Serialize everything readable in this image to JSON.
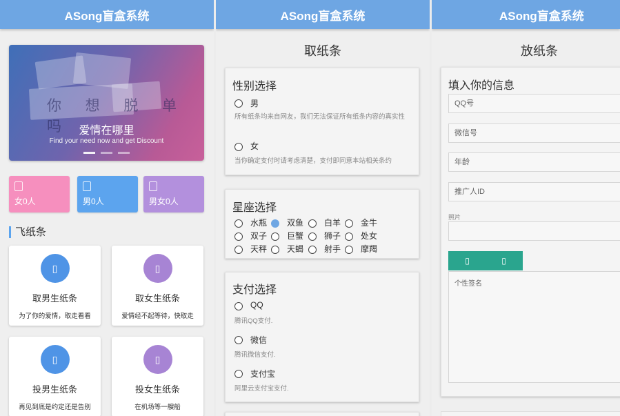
{
  "app_title": "ASong盲盒系统",
  "home": {
    "banner": {
      "title": "爱情在哪里",
      "subtitle": "Find your need now and get Discount",
      "bg_text": "你 想 脱 单 吗"
    },
    "stats": [
      {
        "label": "女0人",
        "color": "#f68fbe",
        "icon": "female-icon"
      },
      {
        "label": "男0人",
        "color": "#5ca4ee",
        "icon": "male-icon"
      },
      {
        "label": "男女0人",
        "color": "#b390dd",
        "icon": "group-icon"
      }
    ],
    "section_title": "飞纸条",
    "cards": [
      {
        "title": "取男生纸条",
        "desc": "为了你的爱情，取走看看"
      },
      {
        "title": "取女生纸条",
        "desc": "爱情经不起等待，快取走"
      },
      {
        "title": "投男生纸条",
        "desc": "再见到底是约定还是告别"
      },
      {
        "title": "投女生纸条",
        "desc": "在机场等一艘船"
      }
    ]
  },
  "take": {
    "title": "取纸条",
    "gender": {
      "heading": "性别选择",
      "options": [
        {
          "label": "男",
          "note": "所有纸条均来自网友，我们无法保证所有纸条内容的真实性"
        },
        {
          "label": "女",
          "note": "当你确定支付时请考虑清楚，支付即同意本站相关条约"
        }
      ]
    },
    "zodiac": {
      "heading": "星座选择",
      "selected": "双鱼",
      "options": [
        "水瓶",
        "双鱼",
        "白羊",
        "金牛",
        "双子",
        "巨蟹",
        "狮子",
        "处女",
        "天秤",
        "天蝎",
        "射手",
        "摩羯"
      ]
    },
    "payment": {
      "heading": "支付选择",
      "options": [
        {
          "label": "QQ",
          "note": "腾讯QQ支付."
        },
        {
          "label": "微信",
          "note": "腾讯微信支付."
        },
        {
          "label": "支付宝",
          "note": "阿里云支付宝支付."
        }
      ]
    }
  },
  "put": {
    "title": "放纸条",
    "form_heading": "填入你的信息",
    "qq_placeholder": "QQ号",
    "wechat_placeholder": "微信号",
    "age_placeholder": "年龄",
    "promoter_placeholder": "推广人ID",
    "photo_label": "照片",
    "signature_placeholder": "个性签名",
    "accent": "#2aa58e"
  }
}
